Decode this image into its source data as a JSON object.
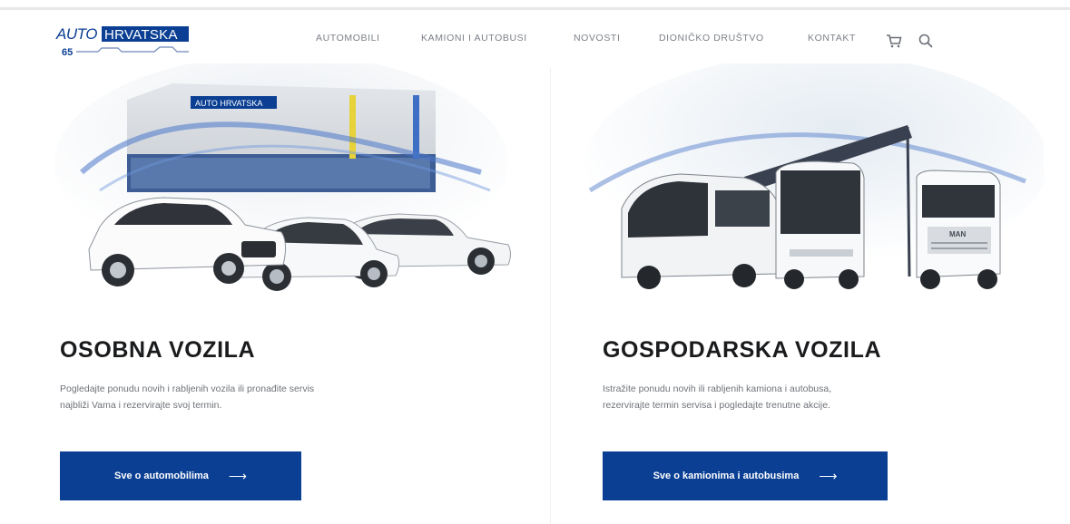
{
  "brand": {
    "logo_text_left": "AUTO",
    "logo_text_right": "HRVATSKA",
    "logo_sub": "65",
    "brand_blue": "#0b3f93"
  },
  "nav": {
    "items": [
      {
        "label": "AUTOMOBILI"
      },
      {
        "label": "KAMIONI I AUTOBUSI"
      },
      {
        "label": "NOVOSTI"
      },
      {
        "label": "DIONIČKO DRUŠTVO"
      },
      {
        "label": "KONTAKT"
      }
    ],
    "icons": [
      "cart-icon",
      "search-icon"
    ]
  },
  "sections": {
    "left": {
      "title": "OSOBNA VOZILA",
      "description": "Pogledajte ponudu novih i rabljenih vozila ili pronađite servis najbliži Vama i rezervirajte svoj termin.",
      "button_label": "Sve o automobilima",
      "button_arrow": "⟶",
      "building_sign": "AUTO HRVATSKA"
    },
    "right": {
      "title": "GOSPODARSKA VOZILA",
      "description": "Istražite ponudu novih ili rabljenih kamiona i autobusa, rezervirajte termin servisa i pogledajte trenutne akcije.",
      "button_label": "Sve o kamionima i autobusima",
      "button_arrow": "⟶",
      "truck_badge": "MAN"
    }
  }
}
